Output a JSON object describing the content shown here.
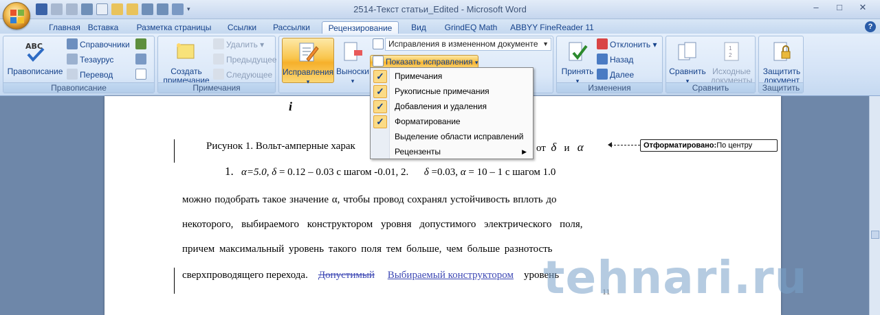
{
  "window": {
    "title": "2514-Текст статьи_Edited - Microsoft Word",
    "controls": [
      "–",
      "□",
      "✕"
    ]
  },
  "tabs": [
    {
      "label": "Главная",
      "active": false
    },
    {
      "label": "Вставка",
      "active": false
    },
    {
      "label": "Разметка страницы",
      "active": false
    },
    {
      "label": "Ссылки",
      "active": false
    },
    {
      "label": "Рассылки",
      "active": false
    },
    {
      "label": "Рецензирование",
      "active": true
    },
    {
      "label": "Вид",
      "active": false
    },
    {
      "label": "GrindEQ Math",
      "active": false
    },
    {
      "label": "ABBYY FineReader 11",
      "active": false
    }
  ],
  "help": "?",
  "ribbon": {
    "spelling": {
      "big": "Правописание",
      "small": [
        "Справочники",
        "Тезаурус",
        "Перевод"
      ],
      "group": "Правописание"
    },
    "comments": {
      "big": "Создать примечание",
      "small": [
        "Удалить",
        "Предыдущее",
        "Следующее"
      ],
      "group": "Примечания"
    },
    "tracking": {
      "track_changes": "Исправления",
      "balloons": "Выноски",
      "display_mode": "Исправления в измененном документе",
      "show_markup": "Показать исправления"
    },
    "changes": {
      "accept": "Принять",
      "small": [
        "Отклонить",
        "Назад",
        "Далее"
      ],
      "group": "Изменения"
    },
    "compare": {
      "compare": "Сравнить",
      "source": "Исходные документы",
      "group": "Сравнить"
    },
    "protect": {
      "protect": "Защитить документ",
      "group": "Защитить"
    }
  },
  "menu": {
    "items": [
      {
        "label": "Примечания",
        "checked": true,
        "submenu": false
      },
      {
        "label": "Рукописные примечания",
        "checked": true,
        "submenu": false
      },
      {
        "label": "Добавления и удаления",
        "checked": true,
        "submenu": false
      },
      {
        "label": "Форматирование",
        "checked": true,
        "submenu": false
      },
      {
        "label": "Выделение области исправлений",
        "checked": false,
        "submenu": false
      },
      {
        "label": "Рецензенты",
        "checked": false,
        "submenu": true
      }
    ]
  },
  "document": {
    "symbol_i": "i",
    "caption_start": "Рисунок 1.  Вольт-амперные харак",
    "caption_end": "от",
    "delta": "δ",
    "and": "и",
    "alpha": "α",
    "formula": {
      "num1": "1.",
      "part1_italic": "α=5.0, δ",
      "part1": " = 0.12 – 0.03 с шагом -0.01,  2.",
      "part2_italic": "δ",
      "part2": " =0.03, ",
      "part3_italic": "α",
      "part3": " = 10 – 1 с шагом 1.0"
    },
    "lines": [
      "можно  подобрать  такое  значение    α,  чтобы  провод  сохранял  устойчивость  вплоть  до",
      "некоторого,  выбираемого  конструктором  уровня  допустимого  электрического  поля,",
      "причем  максимальный  уровень  такого  поля  тем  больше,  чем  больше  разнотость"
    ],
    "last_line_start": "сверхпроводящего     перехода.",
    "deleted": "Допустимый",
    "inserted": "Выбираемый  конструктором",
    "last_line_end": "уровень",
    "page_number": "11"
  },
  "balloon": {
    "label": "Отформатировано:",
    "value": "По центру"
  },
  "watermark": "tehnari.ru"
}
